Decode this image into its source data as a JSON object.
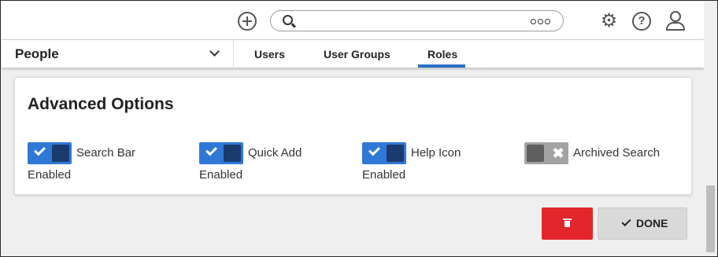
{
  "header": {
    "search_placeholder": "",
    "icons": [
      "add-icon",
      "search-icon",
      "more-icon",
      "gear-icon",
      "help-icon",
      "user-icon"
    ]
  },
  "nav": {
    "module": "People",
    "tabs": [
      {
        "label": "Users",
        "active": false
      },
      {
        "label": "User Groups",
        "active": false
      },
      {
        "label": "Roles",
        "active": true
      }
    ]
  },
  "card": {
    "title": "Advanced Options",
    "options": [
      {
        "label": "Search Bar",
        "enabled": true,
        "status": "Enabled"
      },
      {
        "label": "Quick Add",
        "enabled": true,
        "status": "Enabled"
      },
      {
        "label": "Help Icon",
        "enabled": true,
        "status": "Enabled"
      },
      {
        "label": "Archived Search",
        "enabled": false,
        "status": ""
      }
    ]
  },
  "actions": {
    "done_label": "DONE"
  },
  "colors": {
    "accent": "#2f78d7",
    "toggle_knob_on": "#1b3a6e",
    "toggle_off": "#a3a3a3",
    "danger": "#e3262b",
    "tab_underline": "#2a70c8"
  }
}
